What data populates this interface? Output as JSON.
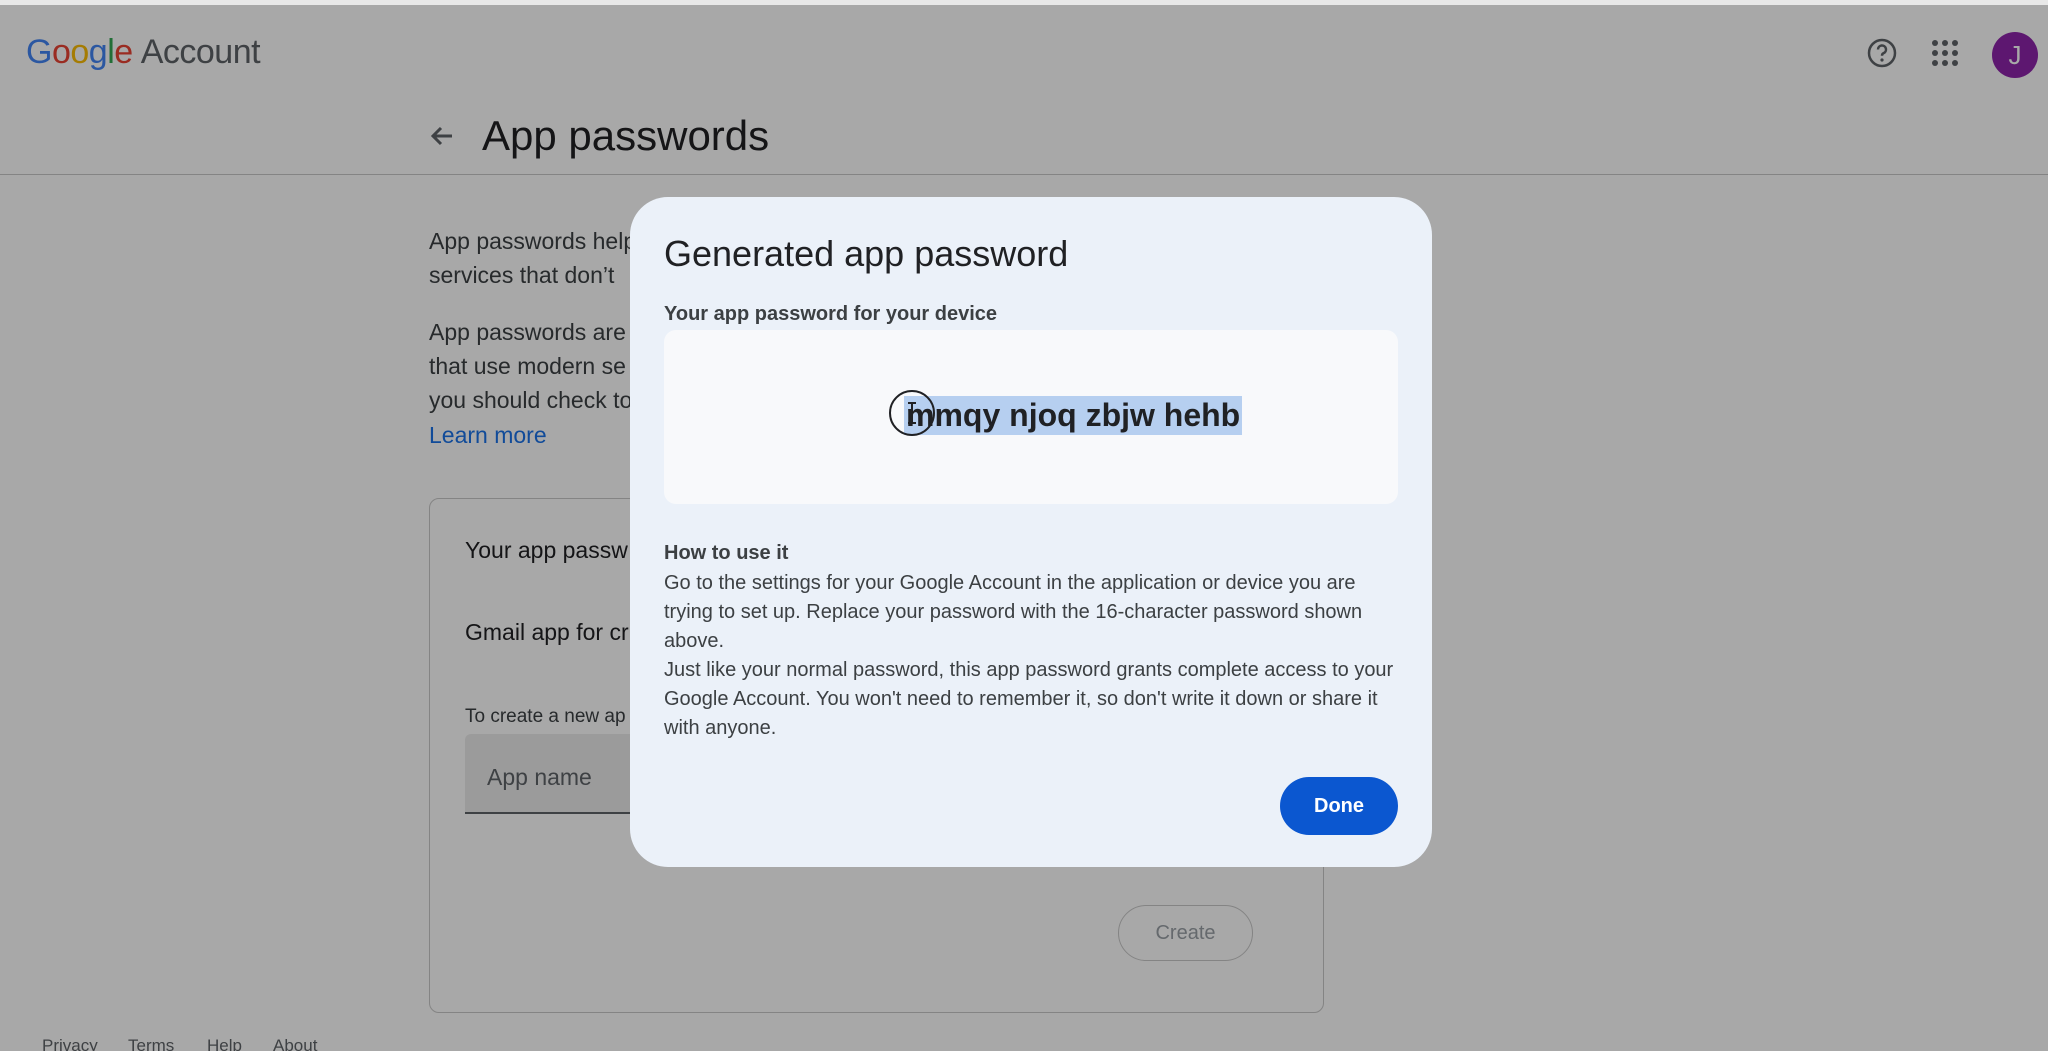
{
  "header": {
    "logo_letters": [
      "G",
      "o",
      "o",
      "g",
      "l",
      "e"
    ],
    "logo_suffix": "Account",
    "avatar_initial": "J",
    "help_icon": "help-circle-icon",
    "apps_icon": "apps-grid-icon"
  },
  "page": {
    "title": "App passwords",
    "back_icon": "arrow-back-icon"
  },
  "background": {
    "para1_line1": "App passwords help",
    "para1_line2": "services that don’t",
    "para2_line1": "App passwords are",
    "para2_line2": "that use modern se",
    "para2_line3": "you should check to",
    "learn_more": "Learn more",
    "card_title": "Your app passw",
    "card_item": "Gmail app for cr",
    "card_note": "To create a new ap",
    "app_name_placeholder": "App name",
    "create_label": "Create"
  },
  "footer": {
    "links": [
      "Privacy",
      "Terms",
      "Help",
      "About"
    ]
  },
  "dialog": {
    "title": "Generated app password",
    "subtitle": "Your app password for your device",
    "password": "mmqy njoq zbjw hehb",
    "howto_title": "How to use it",
    "howto_para1": "Go to the settings for your Google Account in the application or device you are trying to set up. Replace your password with the 16-character password shown above.",
    "howto_para2": "Just like your normal password, this app password grants complete access to your Google Account. You won't need to remember it, so don't write it down or share it with anyone.",
    "done_label": "Done"
  },
  "colors": {
    "brand_blue": "#0b57d0",
    "link_blue": "#1a73e8",
    "avatar_purple": "#8e24aa",
    "dialog_bg": "#ebf1f9",
    "selection_highlight": "#b6cff0"
  }
}
